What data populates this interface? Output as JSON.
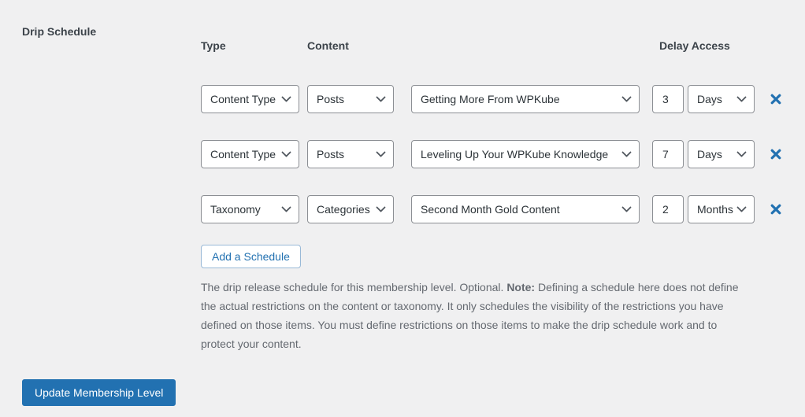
{
  "colors": {
    "background": "#f0f0f1",
    "accent_blue": "#2271b1",
    "border_gray": "#8c8f94",
    "text_dark": "#3c434a",
    "text_muted": "#646970"
  },
  "drip_schedule": {
    "section_label": "Drip Schedule",
    "columns": {
      "type": "Type",
      "content": "Content",
      "delay": "Delay Access"
    },
    "rows": [
      {
        "type": "Content Type",
        "content": "Posts",
        "item": "Getting More From WPKube",
        "delay_value": "3",
        "delay_unit": "Days"
      },
      {
        "type": "Content Type",
        "content": "Posts",
        "item": "Leveling Up Your WPKube Knowledge",
        "delay_value": "7",
        "delay_unit": "Days"
      },
      {
        "type": "Taxonomy",
        "content": "Categories",
        "item": "Second Month Gold Content",
        "delay_value": "2",
        "delay_unit": "Months"
      }
    ],
    "add_button_label": "Add a Schedule",
    "description": {
      "text_before": "The drip release schedule for this membership level. Optional. ",
      "note_label": "Note:",
      "text_after": " Defining a schedule here does not define the actual restrictions on the content or taxonomy. It only schedules the visibility of the restrictions you have defined on those items. You must define restrictions on those items to make the drip schedule work and to protect your content."
    }
  },
  "footer": {
    "update_button_label": "Update Membership Level"
  }
}
